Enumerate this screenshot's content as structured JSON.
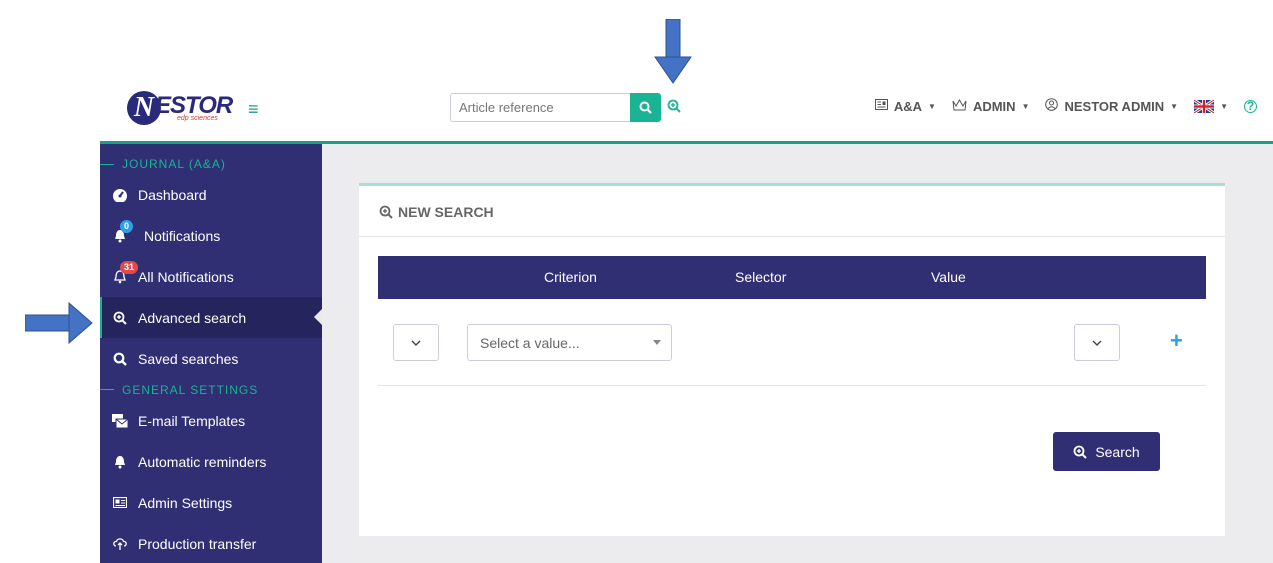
{
  "header": {
    "logo_text": "NESTOR",
    "logo_sub": "edp sciences",
    "search_placeholder": "Article reference",
    "journal_menu": "A&A",
    "role_menu": "ADMIN",
    "user_menu": "NESTOR ADMIN",
    "help_label": "?"
  },
  "sidebar": {
    "section_journal": "JOURNAL (A&A)",
    "section_general": "GENERAL SETTINGS",
    "items": [
      {
        "label": "Dashboard"
      },
      {
        "label": "Notifications",
        "badge": "0"
      },
      {
        "label": "All Notifications",
        "badge": "31"
      },
      {
        "label": "Advanced search"
      },
      {
        "label": "Saved searches"
      },
      {
        "label": "E-mail Templates"
      },
      {
        "label": "Automatic reminders"
      },
      {
        "label": "Admin Settings"
      },
      {
        "label": "Production transfer"
      }
    ]
  },
  "main": {
    "card_title": "NEW SEARCH",
    "columns": [
      "Criterion",
      "Selector",
      "Value"
    ],
    "value_select_placeholder": "Select a value...",
    "add_label": "+",
    "search_button": "Search"
  },
  "colors": {
    "sidebar": "#302f74",
    "accent": "#1ab394",
    "link": "#2ea0e8",
    "badge_red": "#e04a4a",
    "annotation_arrow": "#4472c4"
  }
}
